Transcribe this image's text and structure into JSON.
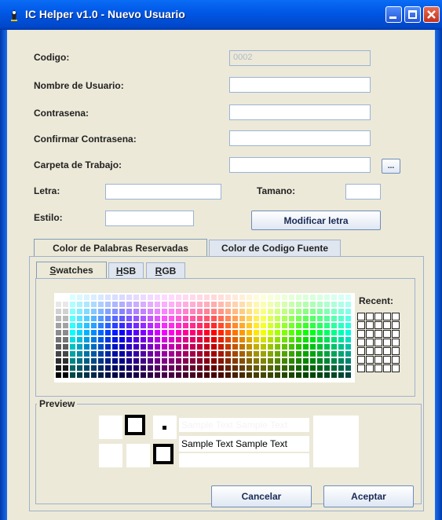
{
  "window": {
    "title": "IC Helper v1.0 - Nuevo Usuario"
  },
  "form": {
    "codigo_label": "Codigo:",
    "codigo_value": "0002",
    "nombre_label": "Nombre de Usuario:",
    "contrasena_label": "Contrasena:",
    "confirmar_label": "Confirmar Contrasena:",
    "carpeta_label": "Carpeta de Trabajo:",
    "browse_label": "...",
    "letra_label": "Letra:",
    "tamano_label": "Tamano:",
    "estilo_label": "Estilo:",
    "modificar_label": "Modificar letra"
  },
  "tabs": [
    {
      "label": "Color de Palabras Reservadas"
    },
    {
      "label": "Color de Codigo Fuente"
    }
  ],
  "subtabs": [
    {
      "mnemonic": "S",
      "rest": "watches"
    },
    {
      "mnemonic": "H",
      "rest": "SB"
    },
    {
      "mnemonic": "R",
      "rest": "GB"
    }
  ],
  "chooser": {
    "recent_label": "Recent:",
    "preview_label": "Preview",
    "sample_text": "Sample Text  Sample Text"
  },
  "buttons": {
    "cancel": "Cancelar",
    "accept": "Aceptar"
  },
  "colors": {
    "titlebar": "#0058e6",
    "window_bg": "#ece9d8",
    "field_border": "#9bb3d6"
  }
}
